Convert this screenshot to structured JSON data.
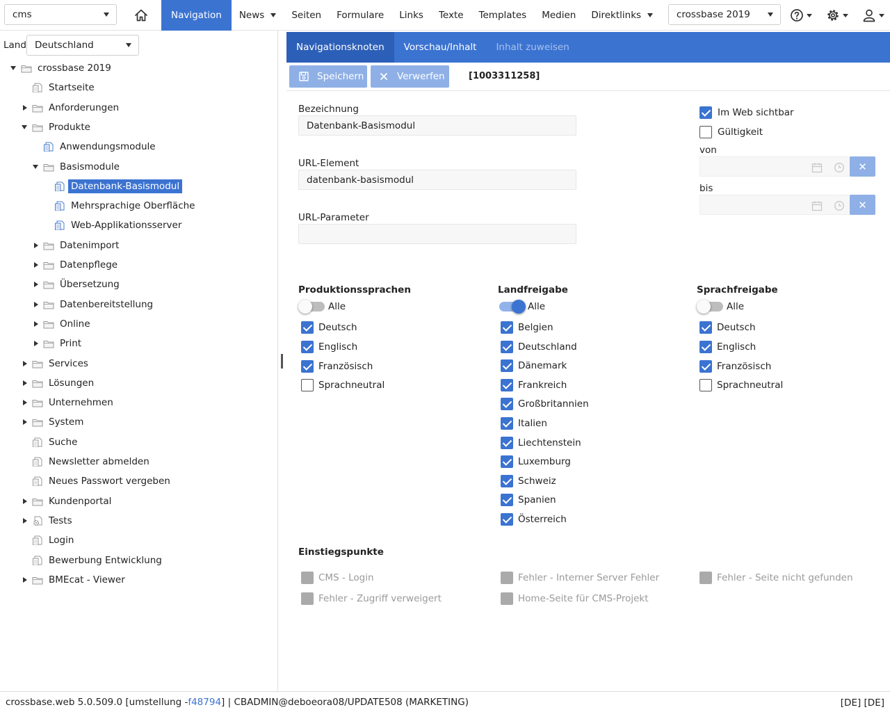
{
  "header": {
    "project_select": "cms",
    "nav": [
      {
        "label": "Navigation",
        "active": true,
        "dropdown": false
      },
      {
        "label": "News",
        "active": false,
        "dropdown": true
      },
      {
        "label": "Seiten",
        "active": false,
        "dropdown": false
      },
      {
        "label": "Formulare",
        "active": false,
        "dropdown": false
      },
      {
        "label": "Links",
        "active": false,
        "dropdown": false
      },
      {
        "label": "Texte",
        "active": false,
        "dropdown": false
      },
      {
        "label": "Templates",
        "active": false,
        "dropdown": false
      },
      {
        "label": "Medien",
        "active": false,
        "dropdown": false
      },
      {
        "label": "Direktlinks",
        "active": false,
        "dropdown": true
      }
    ],
    "site_select": "crossbase 2019",
    "icons": [
      "home-icon",
      "help-icon",
      "settings-icon",
      "user-icon"
    ]
  },
  "sidebar": {
    "land_label": "Land",
    "land_value": "Deutschland",
    "tree": [
      {
        "label": "crossbase 2019",
        "level": 0,
        "state": "expanded",
        "icon": "folder"
      },
      {
        "label": "Startseite",
        "level": 1,
        "state": "leaf",
        "icon": "page"
      },
      {
        "label": "Anforderungen",
        "level": 1,
        "state": "collapsed",
        "icon": "folder"
      },
      {
        "label": "Produkte",
        "level": 1,
        "state": "expanded",
        "icon": "folder"
      },
      {
        "label": "Anwendungsmodule",
        "level": 2,
        "state": "leaf",
        "icon": "page-blue"
      },
      {
        "label": "Basismodule",
        "level": 2,
        "state": "expanded",
        "icon": "folder"
      },
      {
        "label": "Datenbank-Basismodul",
        "level": 3,
        "state": "leaf",
        "icon": "page-blue",
        "selected": true
      },
      {
        "label": "Mehrsprachige Oberfläche",
        "level": 3,
        "state": "leaf",
        "icon": "page-blue"
      },
      {
        "label": "Web-Applikationsserver",
        "level": 3,
        "state": "leaf",
        "icon": "page-blue"
      },
      {
        "label": "Datenimport",
        "level": 2,
        "state": "collapsed",
        "icon": "folder"
      },
      {
        "label": "Datenpflege",
        "level": 2,
        "state": "collapsed",
        "icon": "folder"
      },
      {
        "label": "Übersetzung",
        "level": 2,
        "state": "collapsed",
        "icon": "folder"
      },
      {
        "label": "Datenbereitstellung",
        "level": 2,
        "state": "collapsed",
        "icon": "folder"
      },
      {
        "label": "Online",
        "level": 2,
        "state": "collapsed",
        "icon": "folder"
      },
      {
        "label": "Print",
        "level": 2,
        "state": "collapsed",
        "icon": "folder"
      },
      {
        "label": "Services",
        "level": 1,
        "state": "collapsed",
        "icon": "folder"
      },
      {
        "label": "Lösungen",
        "level": 1,
        "state": "collapsed",
        "icon": "folder"
      },
      {
        "label": "Unternehmen",
        "level": 1,
        "state": "collapsed",
        "icon": "folder"
      },
      {
        "label": "System",
        "level": 1,
        "state": "collapsed",
        "icon": "folder"
      },
      {
        "label": "Suche",
        "level": 1,
        "state": "leaf",
        "icon": "page"
      },
      {
        "label": "Newsletter abmelden",
        "level": 1,
        "state": "leaf",
        "icon": "page"
      },
      {
        "label": "Neues Passwort vergeben",
        "level": 1,
        "state": "leaf",
        "icon": "page"
      },
      {
        "label": "Kundenportal",
        "level": 1,
        "state": "collapsed",
        "icon": "folder"
      },
      {
        "label": "Tests",
        "level": 1,
        "state": "collapsed",
        "icon": "page-gear"
      },
      {
        "label": "Login",
        "level": 1,
        "state": "leaf",
        "icon": "page"
      },
      {
        "label": "Bewerbung Entwicklung",
        "level": 1,
        "state": "leaf",
        "icon": "page"
      },
      {
        "label": "BMEcat - Viewer",
        "level": 1,
        "state": "collapsed",
        "icon": "folder"
      }
    ]
  },
  "tabs": [
    {
      "label": "Navigationsknoten",
      "state": "active"
    },
    {
      "label": "Vorschau/Inhalt",
      "state": "normal"
    },
    {
      "label": "Inhalt zuweisen",
      "state": "disabled"
    }
  ],
  "toolbar": {
    "save_label": "Speichern",
    "discard_label": "Verwerfen",
    "node_id": "[1003311258]"
  },
  "form": {
    "bezeichnung_label": "Bezeichnung",
    "bezeichnung_value": "Datenbank-Basismodul",
    "url_element_label": "URL-Element",
    "url_element_value": "datenbank-basismodul",
    "url_parameter_label": "URL-Parameter",
    "url_parameter_value": "",
    "web_visible_label": "Im Web sichtbar",
    "web_visible": true,
    "validity_label": "Gültigkeit",
    "validity": false,
    "from_label": "von",
    "to_label": "bis",
    "clear_symbol": "✕"
  },
  "columns": [
    {
      "heading": "Produktionssprachen",
      "all_label": "Alle",
      "all_on": false,
      "items": [
        {
          "label": "Deutsch",
          "checked": true
        },
        {
          "label": "Englisch",
          "checked": true
        },
        {
          "label": "Französisch",
          "checked": true
        },
        {
          "label": "Sprachneutral",
          "checked": false
        }
      ]
    },
    {
      "heading": "Landfreigabe",
      "all_label": "Alle",
      "all_on": true,
      "items": [
        {
          "label": "Belgien",
          "checked": true
        },
        {
          "label": "Deutschland",
          "checked": true
        },
        {
          "label": "Dänemark",
          "checked": true
        },
        {
          "label": "Frankreich",
          "checked": true
        },
        {
          "label": "Großbritannien",
          "checked": true
        },
        {
          "label": "Italien",
          "checked": true
        },
        {
          "label": "Liechtenstein",
          "checked": true
        },
        {
          "label": "Luxemburg",
          "checked": true
        },
        {
          "label": "Schweiz",
          "checked": true
        },
        {
          "label": "Spanien",
          "checked": true
        },
        {
          "label": "Österreich",
          "checked": true
        }
      ]
    },
    {
      "heading": "Sprachfreigabe",
      "all_label": "Alle",
      "all_on": false,
      "items": [
        {
          "label": "Deutsch",
          "checked": true
        },
        {
          "label": "Englisch",
          "checked": true
        },
        {
          "label": "Französisch",
          "checked": true
        },
        {
          "label": "Sprachneutral",
          "checked": false
        }
      ]
    }
  ],
  "entry_points": {
    "heading": "Einstiegspunkte",
    "items": [
      {
        "label": "CMS - Login"
      },
      {
        "label": "Fehler - Interner Server Fehler"
      },
      {
        "label": "Fehler - Seite nicht gefunden"
      },
      {
        "label": "Fehler - Zugriff verweigert"
      },
      {
        "label": "Home-Seite für CMS-Projekt"
      }
    ]
  },
  "footer": {
    "version_prefix": "crossbase.web 5.0.509.0 [umstellung  -",
    "hash": "f48794",
    "version_suffix": "] | CBADMIN@deboeora08/UPDATE508 (MARKETING)",
    "locale": "[DE] [DE]"
  },
  "colors": {
    "accent": "#3b73d1",
    "accent_light": "#8fb0e6"
  }
}
